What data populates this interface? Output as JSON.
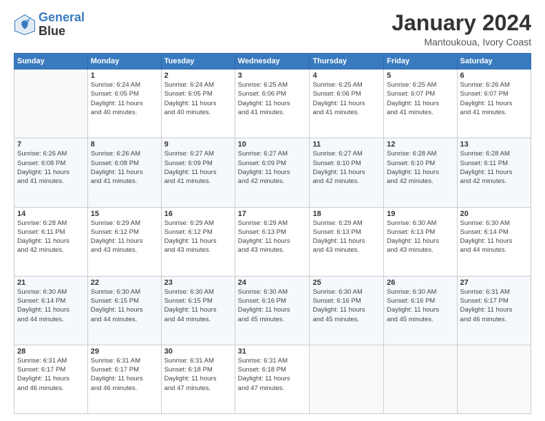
{
  "logo": {
    "line1": "General",
    "line2": "Blue"
  },
  "title": "January 2024",
  "subtitle": "Mantoukoua, Ivory Coast",
  "days_header": [
    "Sunday",
    "Monday",
    "Tuesday",
    "Wednesday",
    "Thursday",
    "Friday",
    "Saturday"
  ],
  "weeks": [
    [
      {
        "day": "",
        "info": ""
      },
      {
        "day": "1",
        "info": "Sunrise: 6:24 AM\nSunset: 6:05 PM\nDaylight: 11 hours\nand 40 minutes."
      },
      {
        "day": "2",
        "info": "Sunrise: 6:24 AM\nSunset: 6:05 PM\nDaylight: 11 hours\nand 40 minutes."
      },
      {
        "day": "3",
        "info": "Sunrise: 6:25 AM\nSunset: 6:06 PM\nDaylight: 11 hours\nand 41 minutes."
      },
      {
        "day": "4",
        "info": "Sunrise: 6:25 AM\nSunset: 6:06 PM\nDaylight: 11 hours\nand 41 minutes."
      },
      {
        "day": "5",
        "info": "Sunrise: 6:25 AM\nSunset: 6:07 PM\nDaylight: 11 hours\nand 41 minutes."
      },
      {
        "day": "6",
        "info": "Sunrise: 6:26 AM\nSunset: 6:07 PM\nDaylight: 11 hours\nand 41 minutes."
      }
    ],
    [
      {
        "day": "7",
        "info": "Sunrise: 6:26 AM\nSunset: 6:08 PM\nDaylight: 11 hours\nand 41 minutes."
      },
      {
        "day": "8",
        "info": "Sunrise: 6:26 AM\nSunset: 6:08 PM\nDaylight: 11 hours\nand 41 minutes."
      },
      {
        "day": "9",
        "info": "Sunrise: 6:27 AM\nSunset: 6:09 PM\nDaylight: 11 hours\nand 41 minutes."
      },
      {
        "day": "10",
        "info": "Sunrise: 6:27 AM\nSunset: 6:09 PM\nDaylight: 11 hours\nand 42 minutes."
      },
      {
        "day": "11",
        "info": "Sunrise: 6:27 AM\nSunset: 6:10 PM\nDaylight: 11 hours\nand 42 minutes."
      },
      {
        "day": "12",
        "info": "Sunrise: 6:28 AM\nSunset: 6:10 PM\nDaylight: 11 hours\nand 42 minutes."
      },
      {
        "day": "13",
        "info": "Sunrise: 6:28 AM\nSunset: 6:11 PM\nDaylight: 11 hours\nand 42 minutes."
      }
    ],
    [
      {
        "day": "14",
        "info": "Sunrise: 6:28 AM\nSunset: 6:11 PM\nDaylight: 11 hours\nand 42 minutes."
      },
      {
        "day": "15",
        "info": "Sunrise: 6:29 AM\nSunset: 6:12 PM\nDaylight: 11 hours\nand 43 minutes."
      },
      {
        "day": "16",
        "info": "Sunrise: 6:29 AM\nSunset: 6:12 PM\nDaylight: 11 hours\nand 43 minutes."
      },
      {
        "day": "17",
        "info": "Sunrise: 6:29 AM\nSunset: 6:13 PM\nDaylight: 11 hours\nand 43 minutes."
      },
      {
        "day": "18",
        "info": "Sunrise: 6:29 AM\nSunset: 6:13 PM\nDaylight: 11 hours\nand 43 minutes."
      },
      {
        "day": "19",
        "info": "Sunrise: 6:30 AM\nSunset: 6:13 PM\nDaylight: 11 hours\nand 43 minutes."
      },
      {
        "day": "20",
        "info": "Sunrise: 6:30 AM\nSunset: 6:14 PM\nDaylight: 11 hours\nand 44 minutes."
      }
    ],
    [
      {
        "day": "21",
        "info": "Sunrise: 6:30 AM\nSunset: 6:14 PM\nDaylight: 11 hours\nand 44 minutes."
      },
      {
        "day": "22",
        "info": "Sunrise: 6:30 AM\nSunset: 6:15 PM\nDaylight: 11 hours\nand 44 minutes."
      },
      {
        "day": "23",
        "info": "Sunrise: 6:30 AM\nSunset: 6:15 PM\nDaylight: 11 hours\nand 44 minutes."
      },
      {
        "day": "24",
        "info": "Sunrise: 6:30 AM\nSunset: 6:16 PM\nDaylight: 11 hours\nand 45 minutes."
      },
      {
        "day": "25",
        "info": "Sunrise: 6:30 AM\nSunset: 6:16 PM\nDaylight: 11 hours\nand 45 minutes."
      },
      {
        "day": "26",
        "info": "Sunrise: 6:30 AM\nSunset: 6:16 PM\nDaylight: 11 hours\nand 45 minutes."
      },
      {
        "day": "27",
        "info": "Sunrise: 6:31 AM\nSunset: 6:17 PM\nDaylight: 11 hours\nand 46 minutes."
      }
    ],
    [
      {
        "day": "28",
        "info": "Sunrise: 6:31 AM\nSunset: 6:17 PM\nDaylight: 11 hours\nand 46 minutes."
      },
      {
        "day": "29",
        "info": "Sunrise: 6:31 AM\nSunset: 6:17 PM\nDaylight: 11 hours\nand 46 minutes."
      },
      {
        "day": "30",
        "info": "Sunrise: 6:31 AM\nSunset: 6:18 PM\nDaylight: 11 hours\nand 47 minutes."
      },
      {
        "day": "31",
        "info": "Sunrise: 6:31 AM\nSunset: 6:18 PM\nDaylight: 11 hours\nand 47 minutes."
      },
      {
        "day": "",
        "info": ""
      },
      {
        "day": "",
        "info": ""
      },
      {
        "day": "",
        "info": ""
      }
    ]
  ]
}
